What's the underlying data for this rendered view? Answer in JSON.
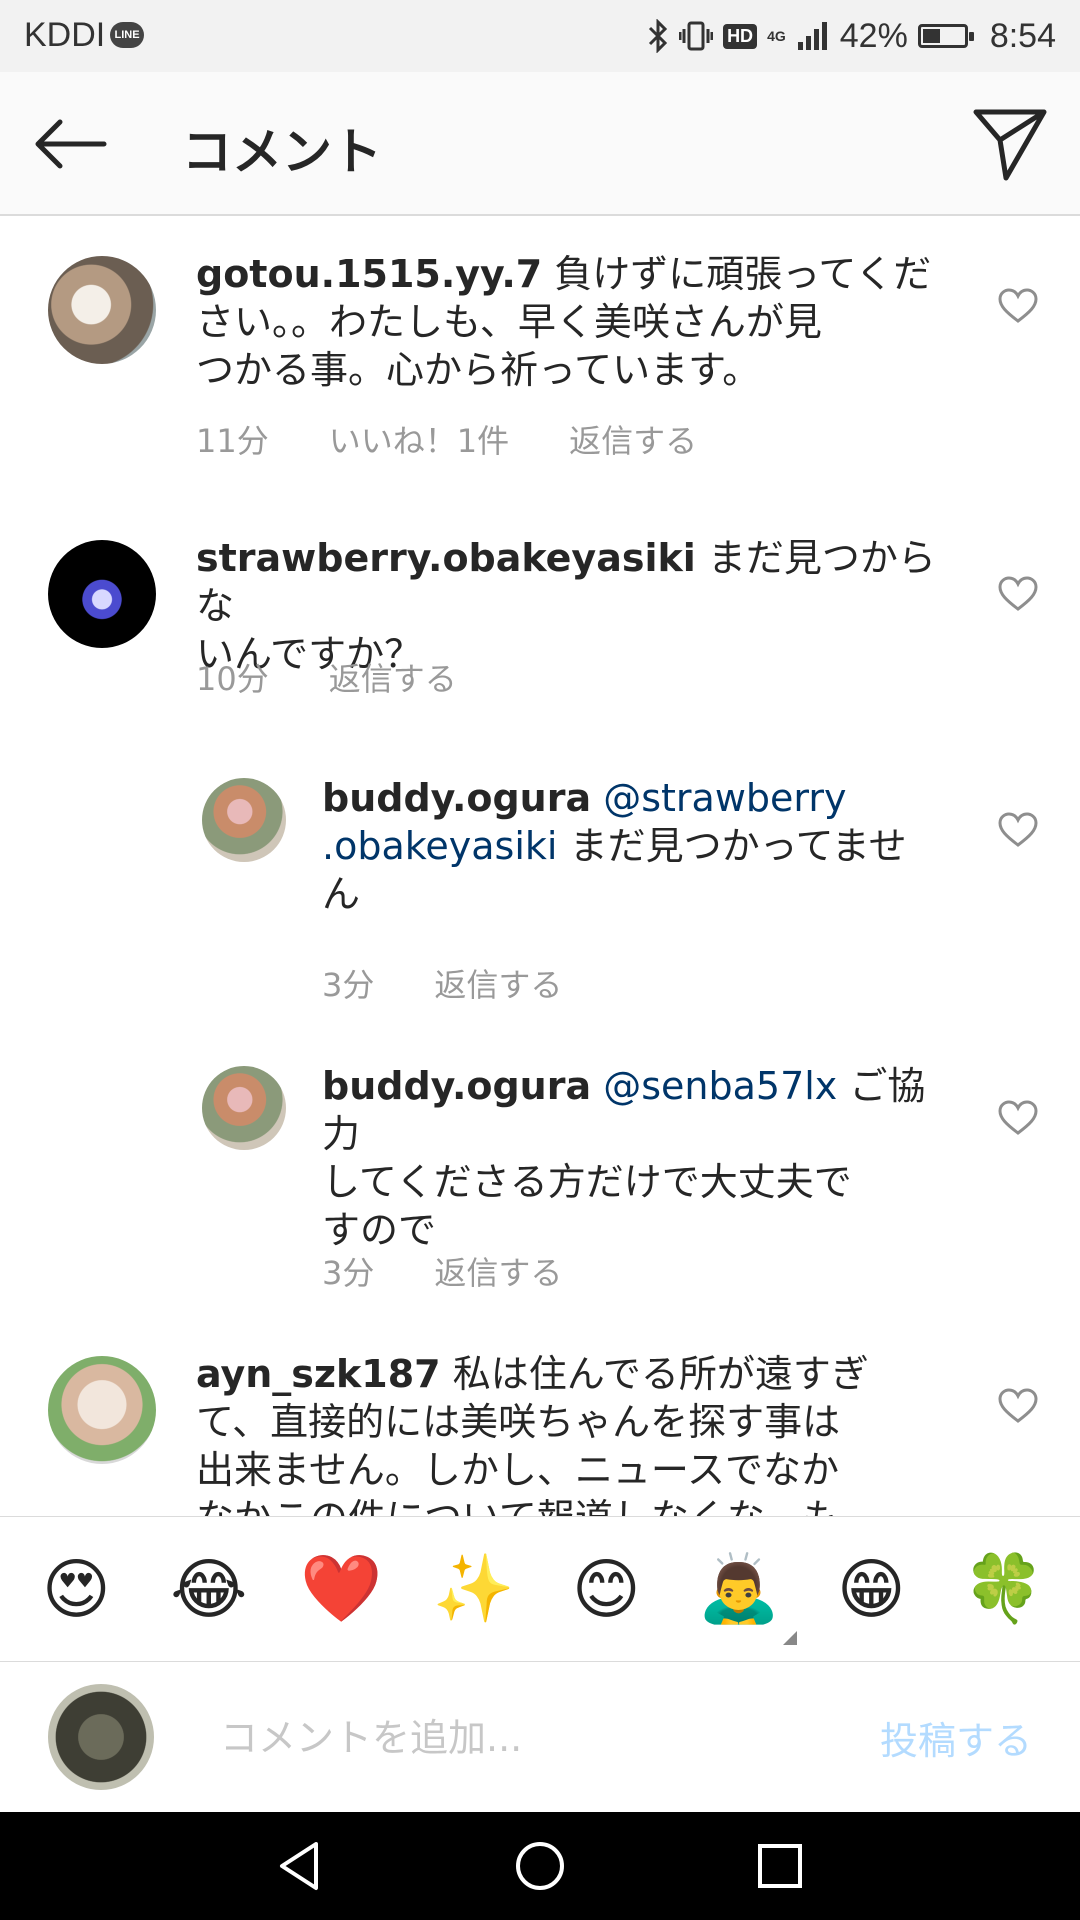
{
  "status_bar": {
    "carrier": "KDDI",
    "line_badge": "LINE",
    "hd": "HD",
    "network": "4G",
    "battery": "42%",
    "battery_level": 0.42,
    "time": "8:54"
  },
  "header": {
    "title": "コメント"
  },
  "comments": [
    {
      "username": "gotou.1515.yy.7",
      "text_lines": [
        "負けずに頑張ってくだ",
        "さい。。わたしも、早く美咲さんが見",
        "つかる事。心から祈っています。"
      ],
      "time": "11分",
      "likes": "いいね！1件",
      "reply": "返信する"
    },
    {
      "username": "strawberry.obakeyasiki",
      "text_lines": [
        "まだ見つからな",
        "いんですか？"
      ],
      "time": "10分",
      "reply": "返信する"
    },
    {
      "username": "buddy.ogura",
      "mention_lines": [
        "@strawberry",
        ".obakeyasiki"
      ],
      "text_lines": [
        "まだ見つかってませ",
        "ん"
      ],
      "time": "3分",
      "reply": "返信する"
    },
    {
      "username": "buddy.ogura",
      "mention": "@senba57lx",
      "text_lines": [
        "ご協力",
        "してくださる方だけで大丈夫で",
        "すので"
      ],
      "time": "3分",
      "reply": "返信する"
    },
    {
      "username": "ayn_szk187",
      "text_lines": [
        "私は住んでる所が遠すぎ",
        "て、直接的には美咲ちゃんを探す事は",
        "出来ません。しかし、ニュースでなか",
        "なかこの件について報道しなくな…も"
      ]
    }
  ],
  "emojis": [
    "😍",
    "😂",
    "❤️",
    "✨",
    "😊",
    "🙇‍♂️",
    "😁",
    "🍀"
  ],
  "compose": {
    "placeholder": "コメントを追加...",
    "post_label": "投稿する"
  },
  "colors": {
    "mention": "#003569",
    "meta": "#999999",
    "post_disabled": "#b3dbff"
  }
}
